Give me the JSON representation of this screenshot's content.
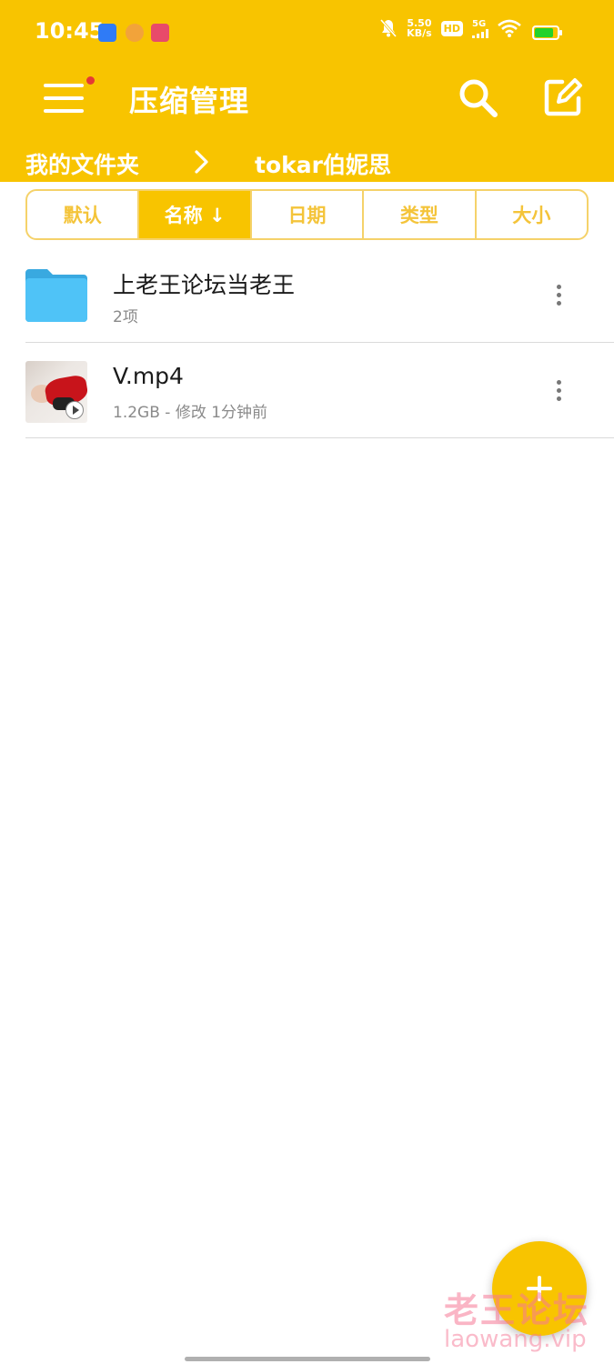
{
  "status_bar": {
    "time": "10:45",
    "speed_value": "5.50",
    "speed_unit": "KB/s",
    "hd_label": "HD",
    "network_label": "5G"
  },
  "toolbar": {
    "title": "压缩管理",
    "menu_icon": "hamburger-menu-icon",
    "search_icon": "search-icon",
    "edit_icon": "edit-icon"
  },
  "breadcrumb": {
    "root": "我的文件夹",
    "current": "tokar伯妮思"
  },
  "sort_tabs": [
    {
      "label": "默认",
      "active": false
    },
    {
      "label": "名称 ↓",
      "active": true
    },
    {
      "label": "日期",
      "active": false
    },
    {
      "label": "类型",
      "active": false
    },
    {
      "label": "大小",
      "active": false
    }
  ],
  "files": [
    {
      "name": "上老王论坛当老王",
      "meta": "2项",
      "type": "folder"
    },
    {
      "name": "V.mp4",
      "meta": "1.2GB - 修改 1分钟前",
      "type": "video"
    }
  ],
  "watermark": {
    "text_cn": "老王论坛",
    "text_en": "laowang.vip"
  },
  "colors": {
    "accent": "#F8C400",
    "folder": "#4FC3F7",
    "notification_dot": "#E53935"
  }
}
